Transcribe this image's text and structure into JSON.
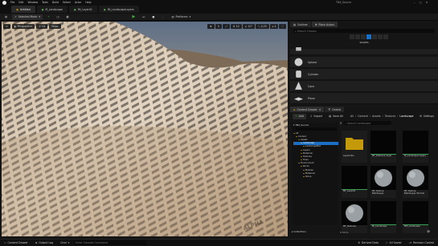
{
  "menu": [
    "File",
    "Edit",
    "Window",
    "Tools",
    "Build",
    "Select",
    "Actor",
    "Help"
  ],
  "tabs": [
    "Untitled",
    "M_Landscape",
    "MI_Layer01",
    "MI_LandscapeLayers"
  ],
  "title_right": "TNX_Source",
  "settings_label": "Settings",
  "toolbar": {
    "mode_label": "Selected Mode",
    "platforms_label": "Platforms"
  },
  "viewport": {
    "perspective": "Perspective",
    "lit": "Lit",
    "show": "Show",
    "tiling_text": "ALPHA",
    "grid_value": "10",
    "angle_value": "10°",
    "scale_value": "0.25",
    "speed_value": "4"
  },
  "outliner": {
    "tab_label": "Outliner",
    "tab2_label": "Place Actors",
    "search_placeholder": "Search Classes",
    "category": "SHAPES"
  },
  "shapes": [
    "Sphere",
    "Cylinder",
    "Cone",
    "Plane"
  ],
  "content_browser": {
    "tab_label": "Content Drawer",
    "details_label": "Details",
    "add_label": "Add",
    "import_label": "Import",
    "save_all_label": "Save All",
    "breadcrumb": [
      "All",
      "Content",
      "Assets",
      "Textures",
      "Landscape"
    ],
    "settings_label": "Settings",
    "source_label": "TNX_Source",
    "search_placeholder": "Search Landscape",
    "tree": [
      "All",
      "Content",
      "Assets",
      "Landscape",
      "LandscapeMat",
      "Layers",
      "Materials",
      "Textures",
      "Trees",
      "Environment",
      "Rocks",
      "Meshes",
      "Materials",
      "Stone"
    ],
    "assets": [
      {
        "label": "LayerInfos",
        "kind": "folder"
      },
      {
        "label": "MF_Distance Layer",
        "kind": "dark"
      },
      {
        "label": "M_Landscape Layers",
        "kind": "dark"
      },
      {
        "label": "MF_Layer01",
        "kind": "dark"
      },
      {
        "label": "MF_Texture BlendLayer",
        "kind": "sphere"
      },
      {
        "label": "MF_Texture BlendLayer Normal",
        "kind": "sphere"
      },
      {
        "label": "MF_Textures",
        "kind": "sphere"
      },
      {
        "label": "MI_Landscape",
        "kind": "dark"
      },
      {
        "label": "MM_Landscape",
        "kind": "dark"
      }
    ],
    "collections_label": "Collections",
    "items_label": "8 items"
  },
  "statusbar": {
    "content_drawer": "Content Drawer",
    "output_log": "Output Log",
    "cmd_label": "Cmd",
    "console_placeholder": "Enter Console Command",
    "derived_data": "Derived Data",
    "all_saved": "All Saved",
    "revision_control": "Revision Control"
  },
  "colors": {
    "accent": "#c59a0a",
    "play_green": "#45b03d",
    "selection_blue": "#1a6fc4"
  }
}
